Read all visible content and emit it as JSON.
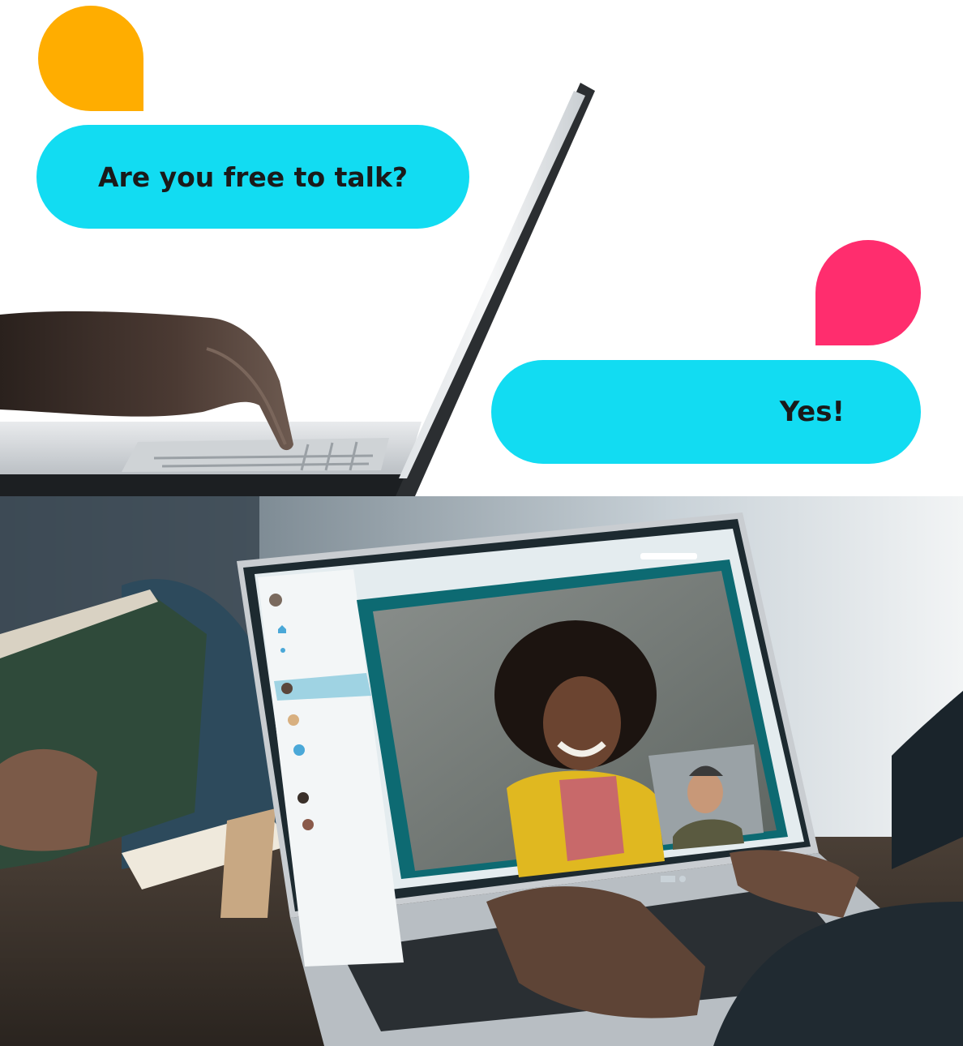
{
  "chat": {
    "question": "Are you free to talk?",
    "answer": "Yes!"
  },
  "colors": {
    "bubble": "#12dcf2",
    "dot_question": "#ffad00",
    "dot_answer": "#ff2d6e",
    "app_sidebar_highlight": "#9fd3e3"
  },
  "icons": {
    "home": "home-icon",
    "person": "person-icon"
  }
}
